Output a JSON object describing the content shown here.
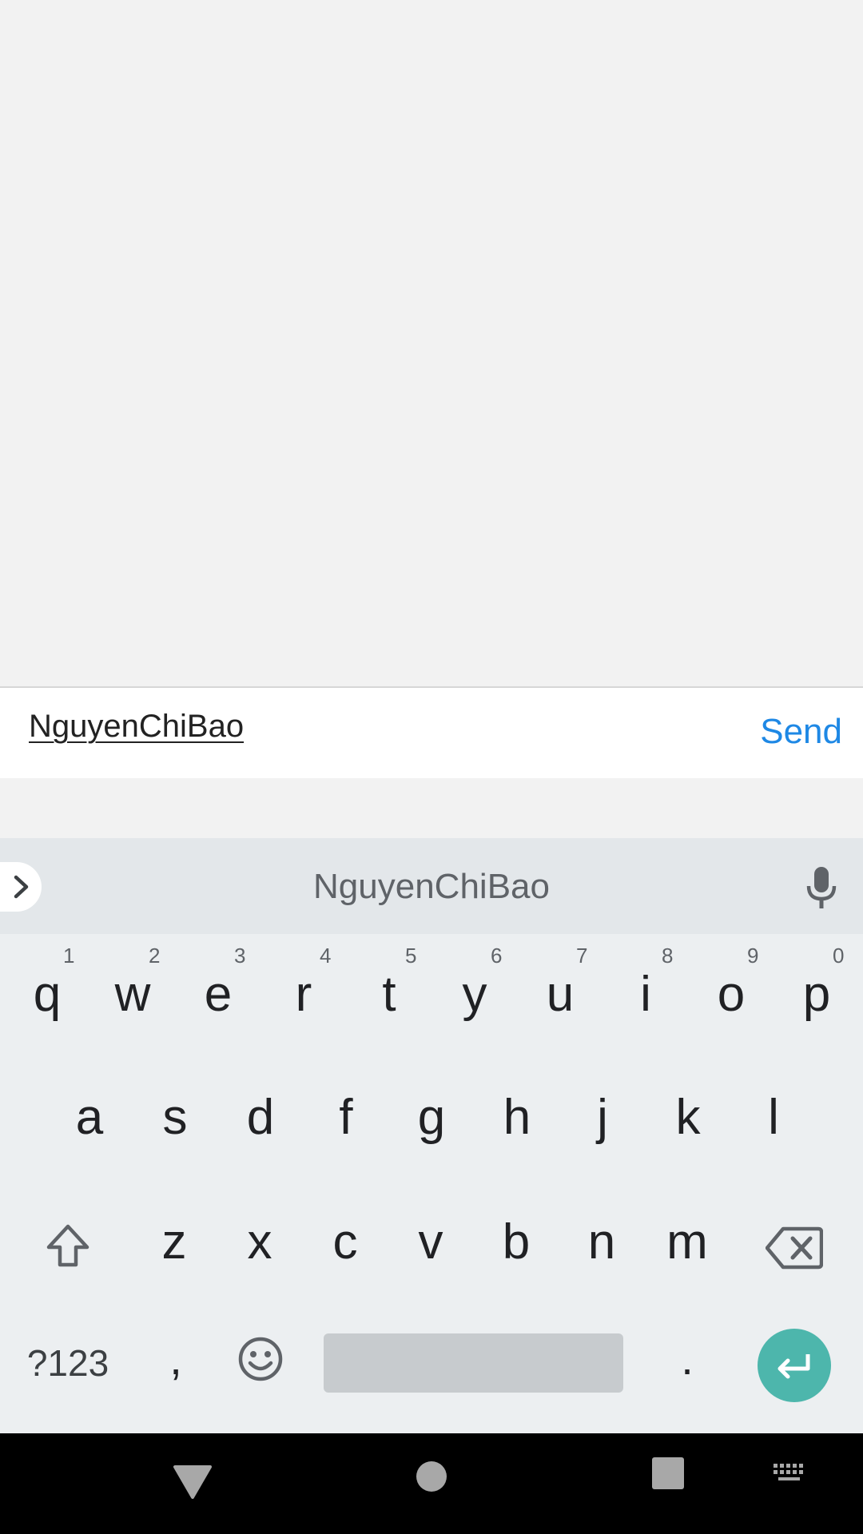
{
  "compose": {
    "input_value": "NguyenChiBao",
    "send_label": "Send"
  },
  "keyboard": {
    "suggestion": "NguyenChiBao",
    "row1": [
      "q",
      "w",
      "e",
      "r",
      "t",
      "y",
      "u",
      "i",
      "o",
      "p"
    ],
    "row1_hints": [
      "1",
      "2",
      "3",
      "4",
      "5",
      "6",
      "7",
      "8",
      "9",
      "0"
    ],
    "row2": [
      "a",
      "s",
      "d",
      "f",
      "g",
      "h",
      "j",
      "k",
      "l"
    ],
    "row3": [
      "z",
      "x",
      "c",
      "v",
      "b",
      "n",
      "m"
    ],
    "symbols_label": "?123",
    "comma": ",",
    "period": "."
  },
  "colors": {
    "accent": "#1e88e5",
    "enter_key": "#4db6ac"
  },
  "icons": {
    "expand": "chevron-right-icon",
    "mic": "microphone-icon",
    "shift": "shift-icon",
    "backspace": "backspace-icon",
    "emoji": "emoji-icon",
    "enter": "enter-icon",
    "back": "nav-back-icon",
    "home": "nav-home-icon",
    "recents": "nav-recents-icon",
    "keyboard_switch": "keyboard-icon"
  }
}
